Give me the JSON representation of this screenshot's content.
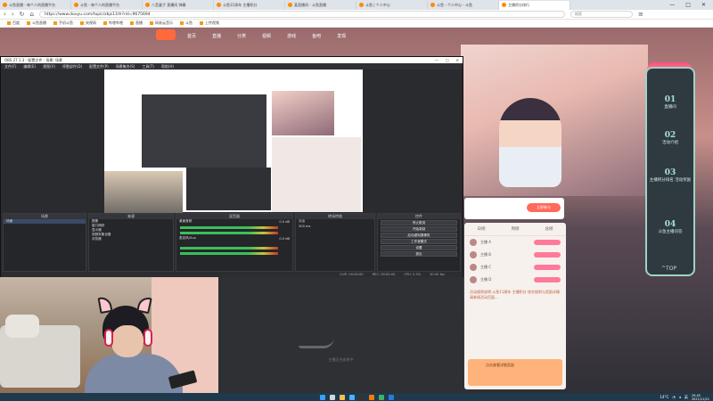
{
  "browser": {
    "tabs": [
      {
        "label": "斗鱼直播 - 每个人的直播平台"
      },
      {
        "label": "斗鱼 - 每个人的直播平台"
      },
      {
        "label": "八音盒子 直播间 弹幕"
      },
      {
        "label": "斗鱼11周年 主播积分"
      },
      {
        "label": "某直播间 - 斗鱼直播"
      },
      {
        "label": "斗鱼 | 个人中心"
      },
      {
        "label": "斗鱼 - 个人中心 - 斗鱼"
      },
      {
        "label": "主播积分排行",
        "active": true
      }
    ],
    "url": "https://www.douyu.com/topic/zbjs11th?rid=9675694",
    "search_placeholder": "搜索",
    "bookmarks": [
      "百度",
      "斗鱼直播",
      "手机斗鱼",
      "央视网",
      "哔哩哔哩",
      "直播",
      "网易云音乐",
      "斗鱼",
      "上传视频"
    ]
  },
  "site": {
    "nav": [
      "首页",
      "直播",
      "分类",
      "视频",
      "游戏",
      "鱼吧",
      "发现"
    ],
    "rank_panel": [
      {
        "num": "01",
        "label": "直播间"
      },
      {
        "num": "02",
        "label": "活动介绍"
      },
      {
        "num": "03",
        "label": "主播积分排名 活动奖励"
      },
      {
        "num": "04",
        "label": "斗鱼主播问答"
      }
    ],
    "to_top": "TOP",
    "gift_button": "立即参与",
    "sidecard": {
      "tabs": [
        "日榜",
        "周榜",
        "总榜"
      ],
      "rows": [
        "主播 A",
        "主播 B",
        "主播 C",
        "主播 D"
      ],
      "text": "活动规则说明 斗鱼11周年 主播积分 排名规则与奖励详情 请参阅活动页面...",
      "ad": "点击查看详细奖励"
    },
    "player_msg": "主播正在休息中"
  },
  "obs": {
    "title": "OBS 27.1.3 - 配置文件 - 场景: 场景",
    "window_buttons": [
      "—",
      "□",
      "✕"
    ],
    "menu": [
      "文件(F)",
      "编辑(E)",
      "视图(V)",
      "停靠部件(D)",
      "配置文件(P)",
      "场景集合(S)",
      "工具(T)",
      "帮助(H)"
    ],
    "docks": {
      "scenes": {
        "title": "场景",
        "items": [
          "场景"
        ]
      },
      "sources": {
        "title": "来源",
        "items": [
          "图像",
          "窗口捕获",
          "显示器",
          "视频采集设备",
          "浏览器"
        ]
      },
      "mixer": {
        "title": "混音器",
        "items": [
          "桌面音频",
          "麦克风/Aux"
        ],
        "levels": [
          "0.0 dB",
          "0.0 dB"
        ]
      },
      "transitions": {
        "title": "转场特效",
        "type": "淡出",
        "duration": "300 ms"
      },
      "controls": {
        "title": "控件",
        "buttons": [
          "停止推流",
          "开始录制",
          "启动虚拟摄像机",
          "工作室模式",
          "设置",
          "退出"
        ]
      }
    },
    "status": [
      "LIVE: 00:00:00",
      "REC: 00:00:00",
      "CPU: 2.3%",
      "30.00 fps"
    ]
  },
  "taskbar": {
    "time": "19:45",
    "date": "2021/11/21",
    "temp": "14°C",
    "lang": "英"
  }
}
